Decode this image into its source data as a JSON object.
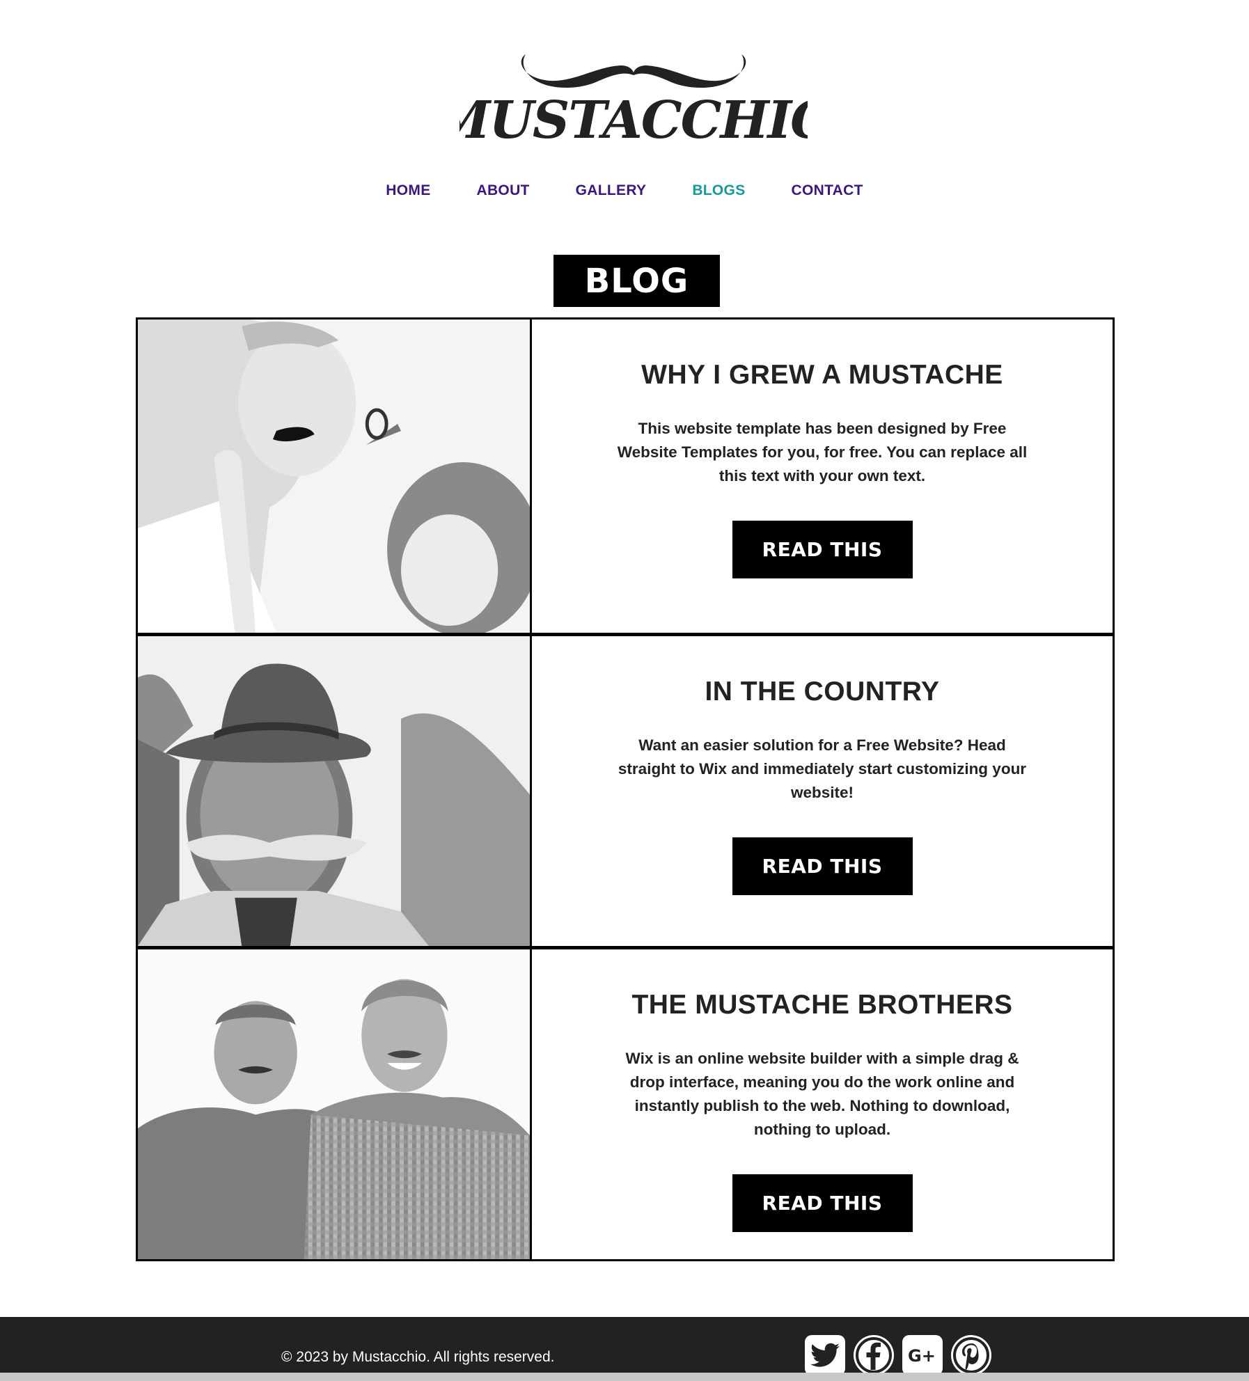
{
  "site": {
    "logo_text": "MUSTACCHIO",
    "nav": [
      {
        "label": "HOME",
        "active": false
      },
      {
        "label": "ABOUT",
        "active": false
      },
      {
        "label": "GALLERY",
        "active": false
      },
      {
        "label": "BLOGS",
        "active": true
      },
      {
        "label": "CONTACT",
        "active": false
      }
    ],
    "colors": {
      "nav": "#3d177e",
      "nav_active": "#15999b",
      "footer": "#222222"
    }
  },
  "blog": {
    "title": "BLOG",
    "posts": [
      {
        "title": "WHY I GREW A MUSTACHE",
        "body": "This website template has been designed by Free Website Templates for you, for free. You can replace all this text with your own text.",
        "button": "READ THIS",
        "image": "girl-trimming-grandfather-mustache-photo"
      },
      {
        "title": "IN THE COUNTRY",
        "body": "Want an easier solution for a Free Website? Head straight to Wix and immediately start customizing your website!",
        "button": "READ THIS",
        "image": "old-man-with-hat-and-mustache-photo"
      },
      {
        "title": "THE MUSTACHE BROTHERS",
        "body": "Wix is an online website builder with a simple drag & drop interface, meaning you do the work online and instantly publish to the web. Nothing to download, nothing to upload.",
        "button": "READ THIS",
        "image": "two-smiling-men-with-mustaches-photo"
      }
    ]
  },
  "footer": {
    "copyright": "© 2023 by Mustacchio. All rights reserved.",
    "social": [
      "twitter-icon",
      "facebook-icon",
      "google-plus-icon",
      "pinterest-icon"
    ]
  }
}
